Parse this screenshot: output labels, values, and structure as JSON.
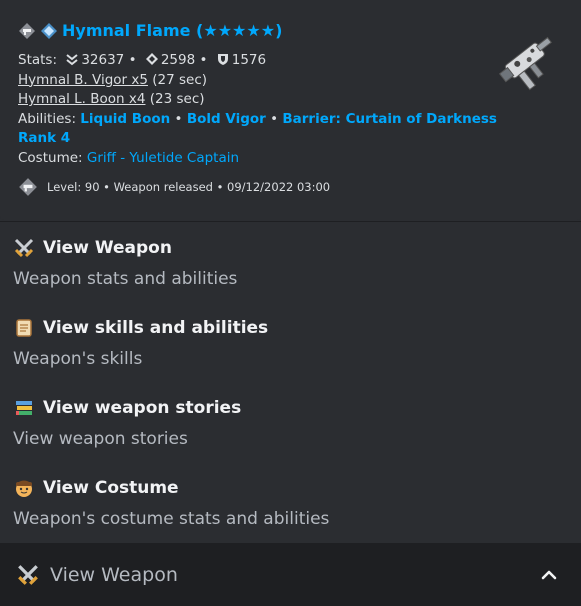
{
  "embed": {
    "title": "Hymnal Flame (★★★★★)",
    "stats_label": "Stats:",
    "stat_hp": "32637",
    "stat_atk": "2598",
    "stat_def": "1576",
    "stat_sep": "•",
    "vigor_link": "Hymnal B. Vigor x5",
    "vigor_dur": "(27 sec)",
    "boon_link": "Hymnal L. Boon x4",
    "boon_dur": "(23 sec)",
    "abilities_label": "Abilities:",
    "ability_1": "Liquid Boon",
    "ability_2": "Bold Vigor",
    "ability_3": "Barrier: Curtain of Darkness",
    "ability_3_cont": "Rank 4",
    "costume_label": "Costume:",
    "costume_value": "Griff - Yuletide Captain",
    "footer_text": "Level: 90 • Weapon released • 09/12/2022 03:00"
  },
  "menu": {
    "options": [
      {
        "title": "View Weapon",
        "desc": "Weapon stats and abilities",
        "icon": "crossed-swords-icon"
      },
      {
        "title": "View skills and abilities",
        "desc": "Weapon's skills",
        "icon": "scroll-icon"
      },
      {
        "title": "View weapon stories",
        "desc": "View weapon stories",
        "icon": "books-icon"
      },
      {
        "title": "View Costume",
        "desc": "Weapon's costume stats and abilities",
        "icon": "face-icon"
      }
    ]
  },
  "select": {
    "selected": "View Weapon",
    "icon": "crossed-swords-icon"
  },
  "colors": {
    "link": "#00a8fc",
    "background": "#2b2d31",
    "select_background": "#1e1f22",
    "text": "#dbdee1",
    "muted": "#b5bac1"
  }
}
